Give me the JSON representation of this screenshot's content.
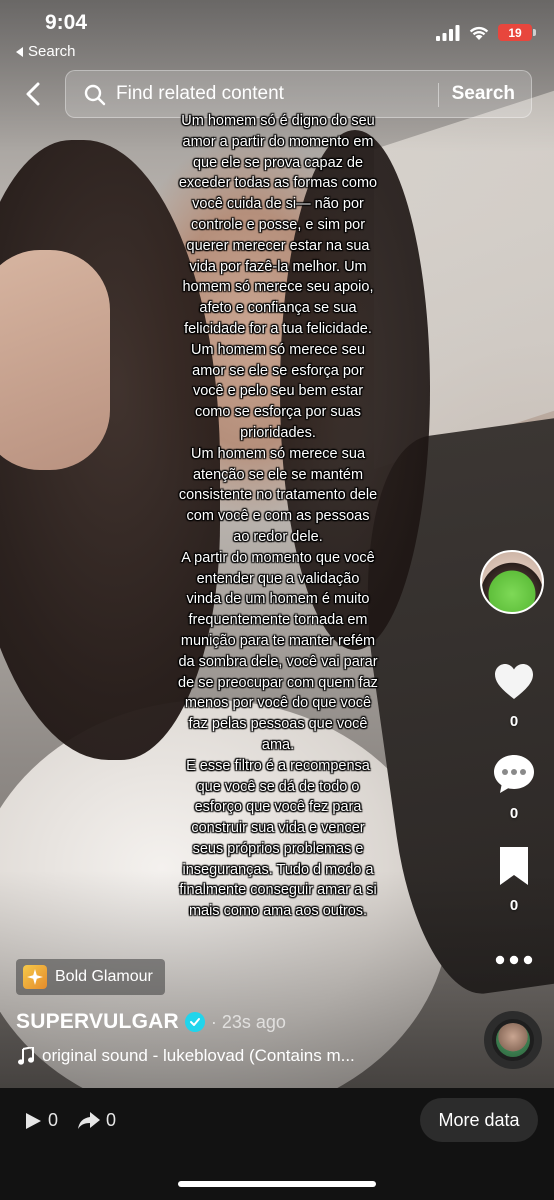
{
  "status_bar": {
    "time": "9:04",
    "back_app_label": "Search",
    "battery": "19"
  },
  "top_bar": {
    "search_placeholder": "Find related content",
    "search_button": "Search"
  },
  "video": {
    "overlay_text": "Um homem só é digno do seu amor a partir do momento em que ele se prova capaz de exceder todas as formas como você cuida de si— não por controle e posse, e sim por querer merecer estar na sua vida por fazê-la melhor. Um homem só merece seu apoio, afeto e confiança se sua felicidade for a tua felicidade. Um homem só merece seu amor se ele se esforça por você e pelo seu bem estar como se esforça por suas prioridades.\nUm homem só merece sua atenção se ele se mantém consistente no tratamento dele com você e com as pessoas ao redor dele.\nA partir do momento que você entender que a validação vinda de um homem é muito frequentemente tornada em munição para te manter refém da sombra dele, você vai parar de se preocupar com quem faz menos por você do que você faz pelas pessoas que você ama.\nE esse filtro é a recompensa que você se dá de todo o esforço que você fez para construir sua vida e vencer seus próprios problemas e inseguranças. Tudo d modo a finalmente conseguir amar a si mais como ama aos outros.",
    "effect_label": "Bold Glamour",
    "username": "SUPERVULGAR",
    "time_ago": "· 23s ago",
    "sound": "original sound - lukeblovad (Contains m..."
  },
  "side_rail": {
    "likes": "0",
    "comments": "0",
    "saves": "0"
  },
  "bottom_bar": {
    "plays": "0",
    "shares": "0",
    "more_data_button": "More data"
  },
  "colors": {
    "battery": "#e8463d",
    "verified": "#20d5ec",
    "bottom_bar_bg": "#121212"
  }
}
